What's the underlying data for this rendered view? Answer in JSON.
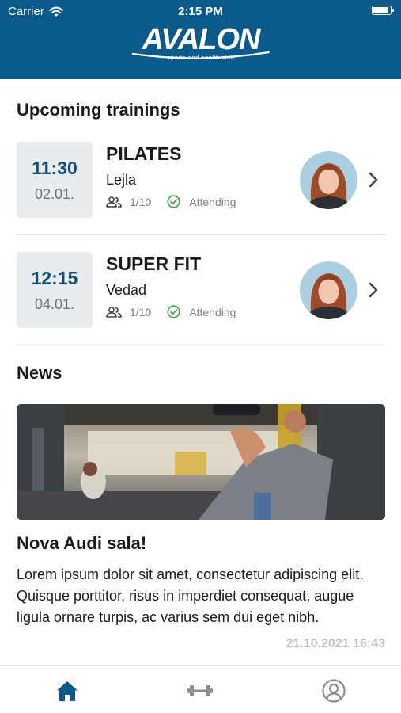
{
  "status_bar": {
    "carrier": "Carrier",
    "time": "2:15 PM",
    "battery_level": 1.0
  },
  "brand": {
    "logo_text": "AVALON",
    "tagline": "sports and health club",
    "header_color": "#0b5a8c"
  },
  "upcoming": {
    "title": "Upcoming trainings",
    "items": [
      {
        "time": "11:30",
        "date": "02.01.",
        "name": "PILATES",
        "trainer": "Lejla",
        "capacity": "1/10",
        "status": "Attending"
      },
      {
        "time": "12:15",
        "date": "04.01.",
        "name": "SUPER FIT",
        "trainer": "Vedad",
        "capacity": "1/10",
        "status": "Attending"
      }
    ]
  },
  "news": {
    "title": "News",
    "article": {
      "title": "Nova Audi sala!",
      "body": "Lorem ipsum dolor sit amet, consectetur adipiscing elit. Quisque porttitor, risus in imperdiet consequat, augue ligula ornare turpis, ac varius sem dui eget nibh.",
      "date": "21.10.2021 16:43"
    }
  },
  "tabbar": {
    "tabs": [
      {
        "icon": "home-icon",
        "active": true
      },
      {
        "icon": "dumbbell-icon",
        "active": false
      },
      {
        "icon": "profile-icon",
        "active": false
      }
    ],
    "active_color": "#0b5a8c",
    "inactive_color": "#8a8f94"
  }
}
